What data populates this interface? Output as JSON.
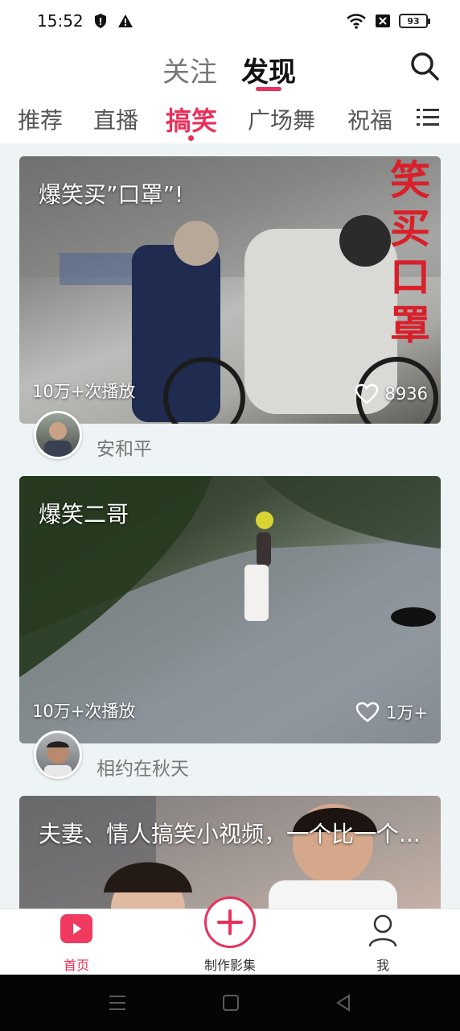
{
  "status_bar": {
    "time": "15:52",
    "battery": "93"
  },
  "header": {
    "tabs": [
      {
        "label": "关注",
        "active": false
      },
      {
        "label": "发现",
        "active": true
      }
    ],
    "accent_color": "#e8315b"
  },
  "categories": {
    "items": [
      {
        "label": "推荐",
        "active": false
      },
      {
        "label": "直播",
        "active": false
      },
      {
        "label": "搞笑",
        "active": true
      },
      {
        "label": "广场舞",
        "active": false
      },
      {
        "label": "祝福",
        "active": false
      }
    ]
  },
  "feed": {
    "cards": [
      {
        "title": "爆笑买”口罩”!",
        "plays": "10万+次播放",
        "likes": "8936",
        "author": "安和平",
        "overlay_text": [
          "笑",
          "买",
          "口",
          "罩"
        ]
      },
      {
        "title": "爆笑二哥",
        "plays": "10万+次播放",
        "likes": "1万+",
        "author": "相约在秋天"
      },
      {
        "title": "夫妻、情人搞笑小视频，一个比一个..."
      }
    ]
  },
  "bottom_nav": {
    "items": [
      {
        "label": "首页",
        "icon": "play-icon",
        "active": true
      },
      {
        "label": "制作影集",
        "icon": "plus-icon",
        "active": false
      },
      {
        "label": "我",
        "icon": "person-icon",
        "active": false
      }
    ]
  }
}
